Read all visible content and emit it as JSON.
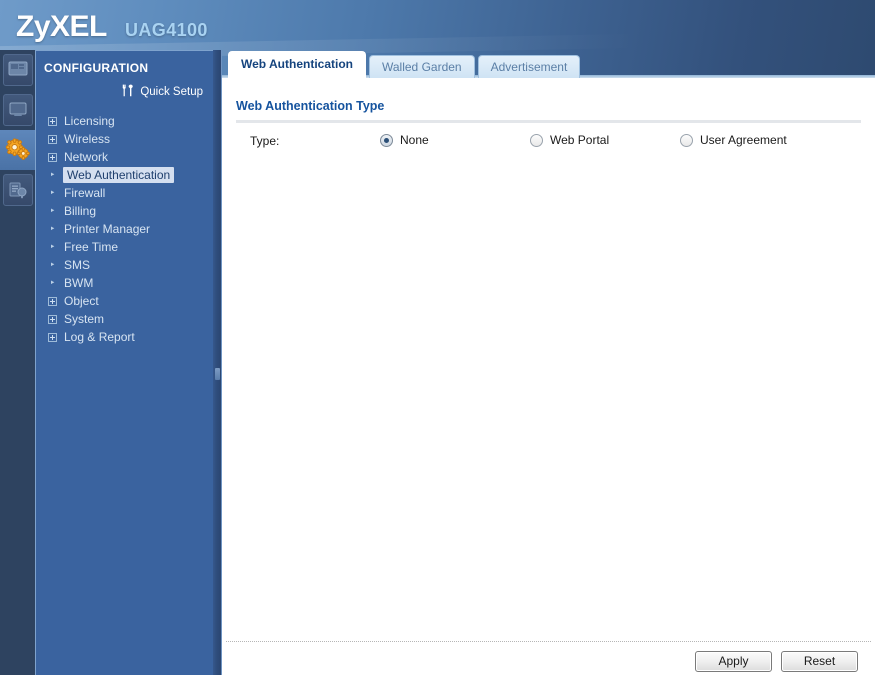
{
  "header": {
    "brand": "ZyXEL",
    "model": "UAG4100"
  },
  "rail": {
    "items": [
      {
        "name": "dashboard-icon",
        "label": "Dashboard",
        "active": false
      },
      {
        "name": "monitor-icon",
        "label": "Monitor",
        "active": false
      },
      {
        "name": "configuration-gears-icon",
        "label": "Configuration",
        "active": true
      },
      {
        "name": "maintenance-icon",
        "label": "Maintenance",
        "active": false
      }
    ]
  },
  "sidebar": {
    "title": "CONFIGURATION",
    "quick_setup": {
      "label": "Quick Setup",
      "icon": "tools-icon"
    },
    "items": [
      {
        "label": "Licensing",
        "marker": "box",
        "selected": false
      },
      {
        "label": "Wireless",
        "marker": "box",
        "selected": false
      },
      {
        "label": "Network",
        "marker": "box",
        "selected": false
      },
      {
        "label": "Web Authentication",
        "marker": "dot",
        "selected": true
      },
      {
        "label": "Firewall",
        "marker": "dot",
        "selected": false
      },
      {
        "label": "Billing",
        "marker": "dot",
        "selected": false
      },
      {
        "label": "Printer Manager",
        "marker": "dot",
        "selected": false
      },
      {
        "label": "Free Time",
        "marker": "dot",
        "selected": false
      },
      {
        "label": "SMS",
        "marker": "dot",
        "selected": false
      },
      {
        "label": "BWM",
        "marker": "dot",
        "selected": false
      },
      {
        "label": "Object",
        "marker": "box",
        "selected": false
      },
      {
        "label": "System",
        "marker": "box",
        "selected": false
      },
      {
        "label": "Log & Report",
        "marker": "box",
        "selected": false
      }
    ]
  },
  "tabs": [
    {
      "label": "Web Authentication",
      "active": true
    },
    {
      "label": "Walled Garden",
      "active": false
    },
    {
      "label": "Advertisement",
      "active": false
    }
  ],
  "main": {
    "panel_title": "Web Authentication Type",
    "type_label": "Type:",
    "options": [
      {
        "label": "None",
        "checked": true
      },
      {
        "label": "Web Portal",
        "checked": false
      },
      {
        "label": "User Agreement",
        "checked": false
      }
    ]
  },
  "footer": {
    "apply_label": "Apply",
    "reset_label": "Reset"
  },
  "colors": {
    "header_light": "#6f9bc9",
    "header_dark": "#2e4a70",
    "sidebar_blue": "#3a639f",
    "rail_navy": "#2e4360",
    "accent_orange": "#f5a623",
    "panel_title_blue": "#15539e",
    "selected_nav_bg": "#d4dff0"
  }
}
